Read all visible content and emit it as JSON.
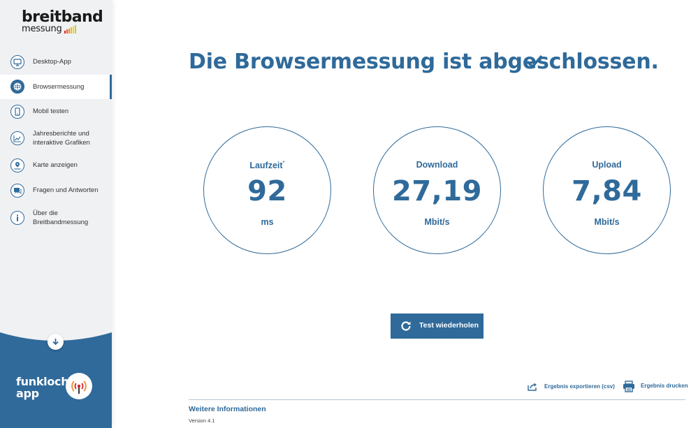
{
  "brand": {
    "logo_line1": "breitband",
    "logo_line2": "messung",
    "logo_bar_colors": [
      "#d8232a",
      "#e9562b",
      "#f08a26",
      "#f5b51f",
      "#f7d51b",
      "#c9d11f"
    ]
  },
  "sidebar": {
    "items": [
      {
        "label": "Desktop-App",
        "icon": "monitor-icon",
        "active": false
      },
      {
        "label": "Browsermessung",
        "icon": "globe-icon",
        "active": true
      },
      {
        "label": "Mobil testen",
        "icon": "smartphone-icon",
        "active": false
      },
      {
        "label": "Jahresberichte und interaktive Grafiken",
        "icon": "chart-icon",
        "active": false
      },
      {
        "label": "Karte anzeigen",
        "icon": "map-pin-icon",
        "active": false
      },
      {
        "label": "Fragen und Antworten",
        "icon": "speech-bubble-icon",
        "active": false
      },
      {
        "label": "Über die Breitbandmessung",
        "icon": "info-icon",
        "active": false
      }
    ],
    "scroll_icon": "arrow-down-icon",
    "promo": {
      "line1": "funkloch-",
      "line2": "app",
      "icon": "antenna-icon"
    }
  },
  "main": {
    "headline": "Die Browsermessung ist abgeschlossen.",
    "headline_icon": "checkmark-icon",
    "gauges": [
      {
        "label": "Laufzeit",
        "marker": "*",
        "value": "92",
        "unit": "ms"
      },
      {
        "label": "Download",
        "marker": "",
        "value": "27,19",
        "unit": "Mbit/s"
      },
      {
        "label": "Upload",
        "marker": "",
        "value": "7,84",
        "unit": "Mbit/s"
      }
    ],
    "retry_button": {
      "label": "Test wiederholen",
      "icon": "refresh-icon"
    },
    "actions": {
      "export_label": "Ergebnis exportieren (csv)",
      "export_icon": "share-icon",
      "print_label": "Ergebnis drucken",
      "print_icon": "printer-icon"
    }
  },
  "footer": {
    "more_info": "Weitere Informationen",
    "version": "Version 4.1"
  },
  "colors": {
    "primary": "#2f6a9a",
    "sidebar_bg": "#f0f1f3",
    "promo_bg": "#2f6a9a"
  }
}
